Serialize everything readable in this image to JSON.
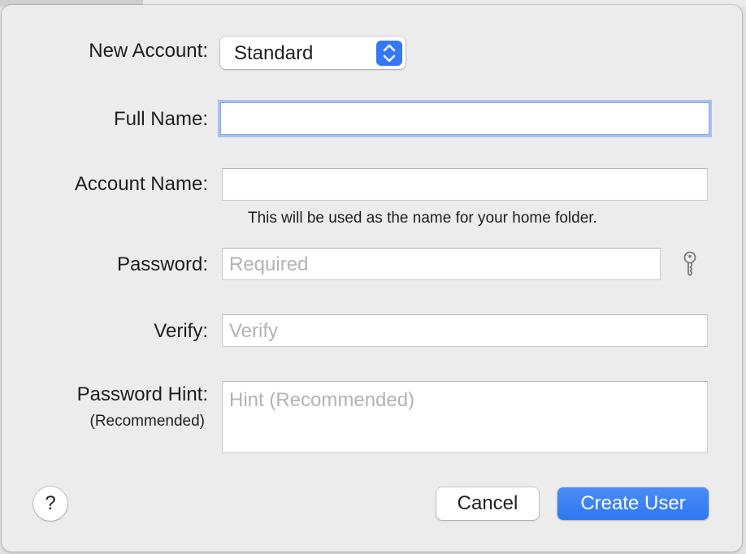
{
  "colors": {
    "accent": "#3478f6",
    "focus_ring": "#a8c1f0",
    "placeholder": "#b3b3b3",
    "sheet_background": "#ececec"
  },
  "form": {
    "account_type": {
      "label": "New Account:",
      "selected": "Standard"
    },
    "full_name": {
      "label": "Full Name:",
      "value": "",
      "placeholder": ""
    },
    "account_name": {
      "label": "Account Name:",
      "value": "",
      "placeholder": "",
      "help_text": "This will be used as the name for your home folder."
    },
    "password": {
      "label": "Password:",
      "placeholder": "Required",
      "assistant_icon": "key-icon"
    },
    "verify": {
      "label": "Verify:",
      "placeholder": "Verify"
    },
    "password_hint": {
      "label": "Password Hint:",
      "sublabel": "(Recommended)",
      "placeholder": "Hint (Recommended)"
    }
  },
  "buttons": {
    "help": "?",
    "cancel": "Cancel",
    "create": "Create User"
  }
}
